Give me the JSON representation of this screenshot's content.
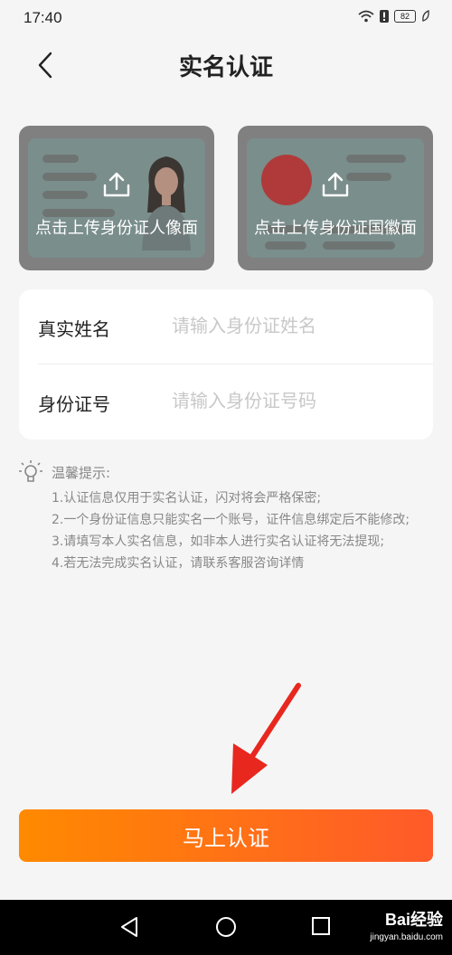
{
  "status_bar": {
    "time": "17:40",
    "battery": "82"
  },
  "header": {
    "title": "实名认证"
  },
  "upload": {
    "front_label": "点击上传身份证人像面",
    "back_label": "点击上传身份证国徽面"
  },
  "form": {
    "name_label": "真实姓名",
    "name_placeholder": "请输入身份证姓名",
    "id_label": "身份证号",
    "id_placeholder": "请输入身份证号码"
  },
  "tips": {
    "title": "温馨提示:",
    "items": [
      "1.认证信息仅用于实名认证，闪对将会严格保密;",
      "2.一个身份证信息只能实名一个账号，证件信息绑定后不能修改;",
      "3.请填写本人实名信息，如非本人进行实名认证将无法提现;",
      "4.若无法完成实名认证，请联系客服咨询详情"
    ]
  },
  "submit": {
    "label": "马上认证"
  },
  "watermark": {
    "brand": "Bai经验",
    "url": "jingyan.baidu.com"
  },
  "colors": {
    "accent_start": "#ff8a00",
    "accent_end": "#ff5a2a",
    "annotation_arrow": "#e8271f"
  }
}
